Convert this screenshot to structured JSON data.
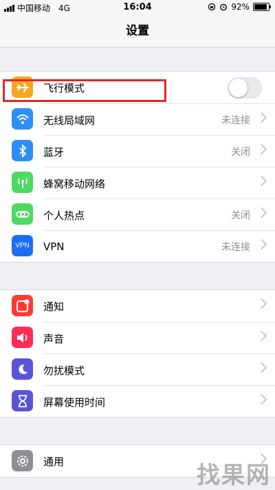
{
  "status_bar": {
    "carrier": "中国移动",
    "network": "4G",
    "time": "16:04",
    "battery": "92%",
    "battery_level": 0.92
  },
  "nav": {
    "title": "设置"
  },
  "group1": [
    {
      "id": "airplane",
      "label": "飞行模式",
      "icon": "airplane-icon",
      "color": "#f5a623",
      "toggle": false
    },
    {
      "id": "wifi",
      "label": "无线局域网",
      "value": "未连接",
      "icon": "wifi-icon",
      "color": "#2e8ef5"
    },
    {
      "id": "bluetooth",
      "label": "蓝牙",
      "value": "关闭",
      "icon": "bluetooth-icon",
      "color": "#2e8ef5"
    },
    {
      "id": "cellular",
      "label": "蜂窝移动网络",
      "icon": "antenna-icon",
      "color": "#4cd964"
    },
    {
      "id": "hotspot",
      "label": "个人热点",
      "value": "关闭",
      "icon": "link-icon",
      "color": "#4cd964"
    },
    {
      "id": "vpn",
      "label": "VPN",
      "value": "未连接",
      "icon": "vpn-icon",
      "icon_text": "VPN",
      "color": "#1d6ff2"
    }
  ],
  "group2": [
    {
      "id": "notifications",
      "label": "通知",
      "icon": "notification-icon",
      "color": "#ff3b30"
    },
    {
      "id": "sounds",
      "label": "声音",
      "icon": "speaker-icon",
      "color": "#ff2d55"
    },
    {
      "id": "dnd",
      "label": "勿扰模式",
      "icon": "moon-icon",
      "color": "#5856d6"
    },
    {
      "id": "screentime",
      "label": "屏幕使用时间",
      "icon": "hourglass-icon",
      "color": "#5856d6"
    }
  ],
  "group3": [
    {
      "id": "general",
      "label": "通用",
      "icon": "gear-icon",
      "color": "#8e8e93"
    }
  ],
  "watermark": "找果网"
}
